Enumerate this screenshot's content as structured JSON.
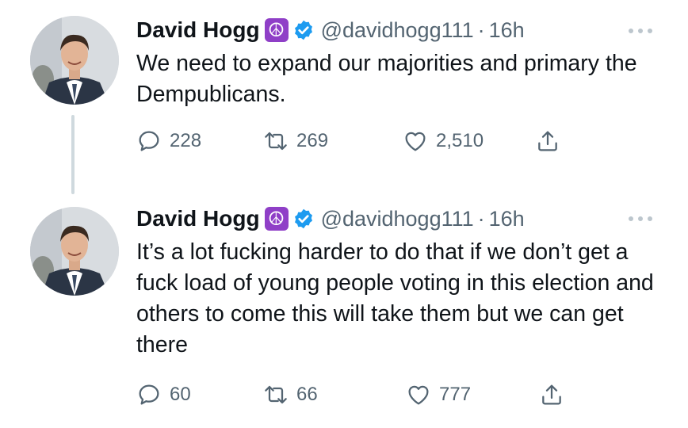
{
  "colors": {
    "text_primary": "#0f1419",
    "text_secondary": "#536471",
    "verified_blue": "#1d9bf0",
    "peace_badge": "#8f3fc7",
    "thread_line": "#cfd9de"
  },
  "tweets": [
    {
      "author_name": "David Hogg",
      "badge_icon": "peace-symbol",
      "badge_glyph": "☮",
      "verified": true,
      "handle": "@davidhogg111",
      "separator": "·",
      "time": "16h",
      "text": "We need to expand our majorities and primary the Dempublicans.",
      "stats": {
        "replies": "228",
        "retweets": "269",
        "likes": "2,510"
      }
    },
    {
      "author_name": "David Hogg",
      "badge_icon": "peace-symbol",
      "badge_glyph": "☮",
      "verified": true,
      "handle": "@davidhogg111",
      "separator": "·",
      "time": "16h",
      "text": "It’s a lot fucking harder to do that if we don’t get a fuck load of young people voting in this election and others to come this will take them but we can get there",
      "stats": {
        "replies": "60",
        "retweets": "66",
        "likes": "777"
      }
    }
  ]
}
